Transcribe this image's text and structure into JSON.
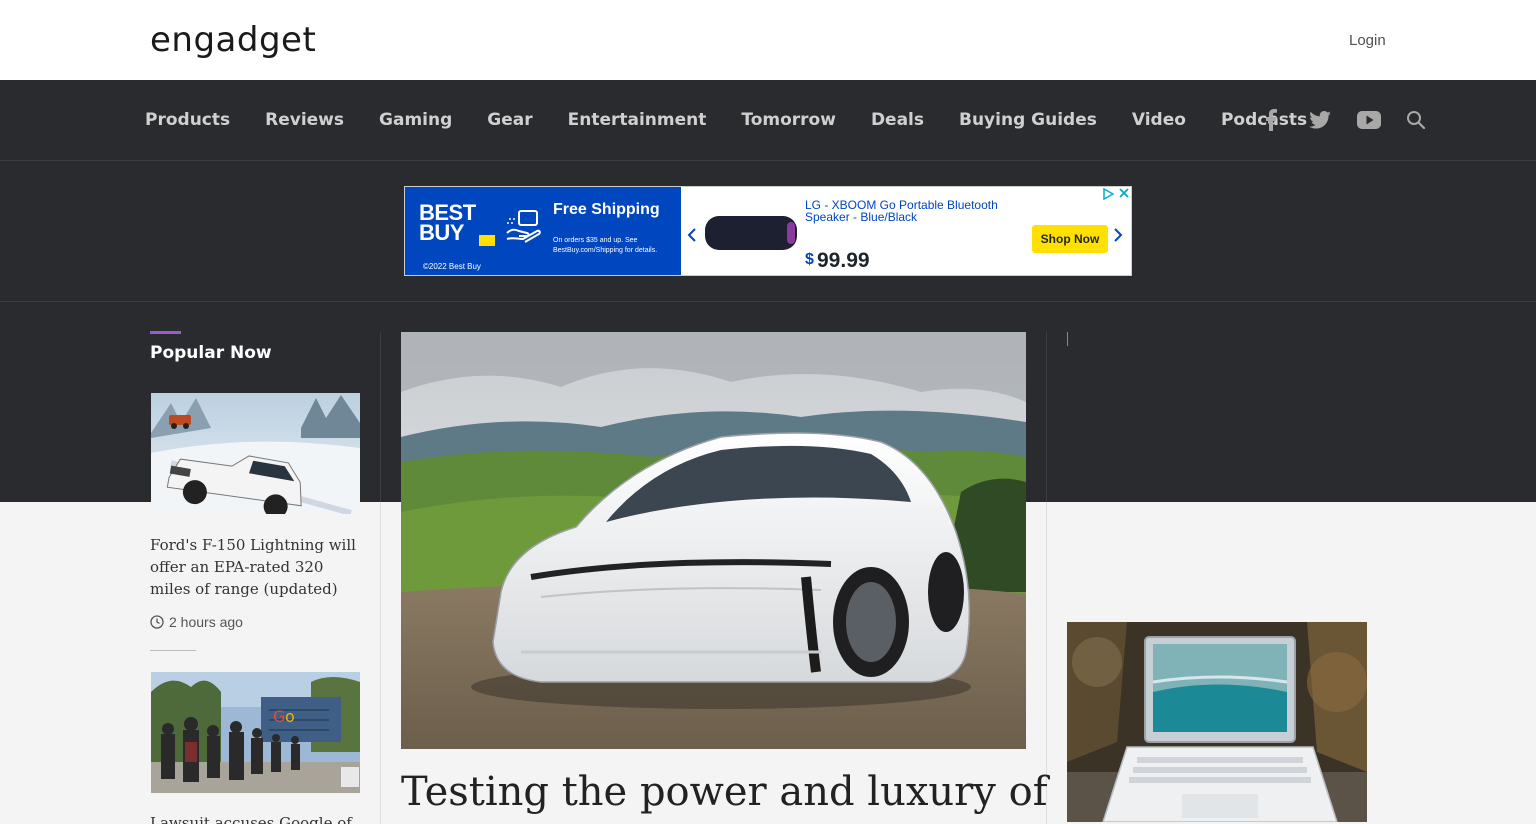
{
  "header": {
    "logo": "engadget",
    "login": "Login"
  },
  "nav": {
    "items": [
      "Products",
      "Reviews",
      "Gaming",
      "Gear",
      "Entertainment",
      "Tomorrow",
      "Deals",
      "Buying Guides",
      "Video",
      "Podcasts"
    ],
    "social_icons": [
      "facebook-icon",
      "twitter-icon",
      "youtube-icon",
      "search-icon"
    ]
  },
  "ad": {
    "brand": "BEST BUY",
    "copyright": "©2022 Best Buy",
    "headline": "Free Shipping",
    "subtext": "On orders $35 and up. See BestBuy.com/Shipping for details.",
    "product_name": "LG - XBOOM Go Portable Bluetooth Speaker - Blue/Black",
    "price_symbol": "$",
    "price": "99.99",
    "cta": "Shop Now"
  },
  "popular": {
    "title": "Popular Now",
    "stories": [
      {
        "title": "Ford's F-150 Lightning will offer an EPA-rated 320 miles of range (updated)",
        "time": "2 hours ago"
      },
      {
        "title": "Lawsuit accuses Google of"
      }
    ]
  },
  "hero": {
    "title": "Testing the power and luxury of"
  },
  "colors": {
    "nav_bg": "#2a2b2e",
    "accent": "#9b59c9",
    "bestbuy_blue": "#0046be",
    "bestbuy_yellow": "#ffe000"
  }
}
